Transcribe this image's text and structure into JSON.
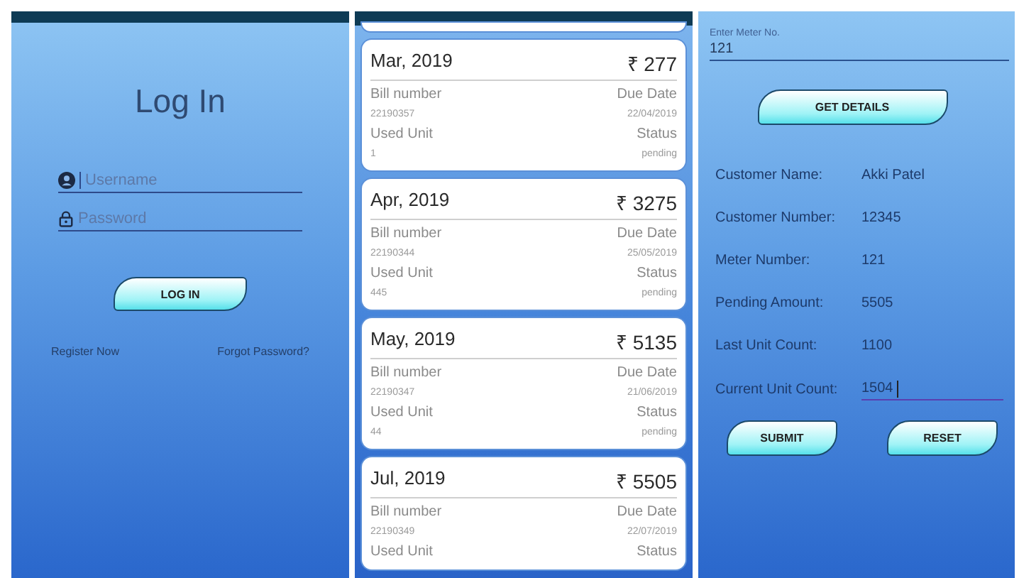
{
  "login": {
    "title": "Log In",
    "fields": [
      {
        "kind": "user",
        "placeholder": "Username",
        "focused": true
      },
      {
        "kind": "lock",
        "placeholder": "Password",
        "focused": false
      }
    ],
    "button": "LOG IN",
    "links": [
      "Register Now",
      "Forgot Password?"
    ]
  },
  "bills": [
    {
      "month": "Mar, 2019",
      "amount": "₹ 277",
      "bill_label": "Bill number",
      "bill_number": "22190357",
      "due_label": "Due Date",
      "due_date": "22/04/2019",
      "unit_label": "Used Unit",
      "used_unit": "1",
      "status_label": "Status",
      "status": "pending"
    },
    {
      "month": "Apr, 2019",
      "amount": "₹ 3275",
      "bill_label": "Bill number",
      "bill_number": "22190344",
      "due_label": "Due Date",
      "due_date": "25/05/2019",
      "unit_label": "Used Unit",
      "used_unit": "445",
      "status_label": "Status",
      "status": "pending"
    },
    {
      "month": "May, 2019",
      "amount": "₹ 5135",
      "bill_label": "Bill number",
      "bill_number": "22190347",
      "due_label": "Due Date",
      "due_date": "21/06/2019",
      "unit_label": "Used Unit",
      "used_unit": "44",
      "status_label": "Status",
      "status": "pending"
    },
    {
      "month": "Jul, 2019",
      "amount": "₹ 5505",
      "bill_label": "Bill number",
      "bill_number": "22190349",
      "due_label": "Due Date",
      "due_date": "22/07/2019",
      "unit_label": "Used Unit",
      "status_label": "Status"
    }
  ],
  "meter": {
    "field": {
      "label": "Enter Meter No.",
      "value": "121"
    },
    "button": "GET DETAILS",
    "details": [
      {
        "kind": "text",
        "label": "Customer Name:",
        "value": "Akki Patel"
      },
      {
        "kind": "text",
        "label": "Customer Number:",
        "value": "12345"
      },
      {
        "kind": "text",
        "label": "Meter Number:",
        "value": "121"
      },
      {
        "kind": "text",
        "label": "Pending Amount:",
        "value": "5505"
      },
      {
        "kind": "text",
        "label": "Last Unit Count:",
        "value": "1100"
      },
      {
        "kind": "input",
        "label": "Current Unit Count:",
        "value": "1504",
        "focused": true
      }
    ],
    "buttons": [
      "SUBMIT",
      "RESET"
    ]
  }
}
